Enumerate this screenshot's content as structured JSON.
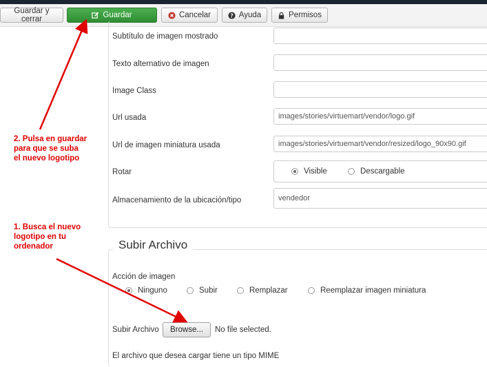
{
  "toolbar": {
    "save_close": "Guardar y cerrar",
    "save": "Guardar",
    "cancel": "Cancelar",
    "help": "Ayuda",
    "permissions": "Permisos"
  },
  "fields": {
    "subtitle_label": "Subtítulo de imagen mostrado",
    "alt_label": "Texto alternativo de imagen",
    "class_label": "Image Class",
    "url_label": "Url usada",
    "url_value": "images/stories/virtuemart/vendor/logo.gif",
    "thumb_label": "Url de imagen miniatura usada",
    "thumb_value": "images/stories/virtuemart/vendor/resized/logo_90x90.gif",
    "rotate_label": "Rotar",
    "rotate_options": [
      "Visible",
      "Descargable"
    ],
    "storage_label": "Almacenamiento de la ubicación/tipo",
    "storage_value": "vendedor"
  },
  "upload": {
    "legend": "Subir Archivo",
    "action_label": "Acción de imagen",
    "action_options": [
      "Ninguno",
      "Subir",
      "Remplazar",
      "Reemplazar imagen miniatura"
    ],
    "file_label": "Subir Archivo",
    "browse": "Browse...",
    "no_file": "No file selected.",
    "truncated": "El archivo que desea cargar tiene un tipo MIME"
  },
  "annotations": {
    "step2": [
      "2. Pulsa en guardar",
      "para que se suba",
      "el nuevo logotipo"
    ],
    "step1": [
      "1. Busca el nuevo",
      "logotipo en tu",
      "ordenador"
    ]
  },
  "colors": {
    "annotation": "#e10000",
    "save_button": "#3a9b3e"
  }
}
